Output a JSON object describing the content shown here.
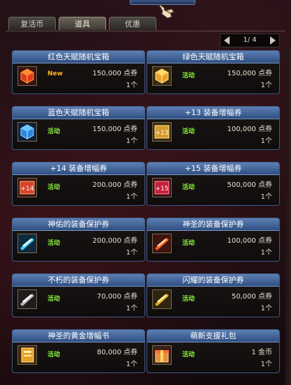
{
  "tabs": [
    {
      "label": "复活币",
      "active": false
    },
    {
      "label": "道具",
      "active": true
    },
    {
      "label": "优惠",
      "active": false
    }
  ],
  "pager": {
    "text": "1/ 4"
  },
  "items": [
    {
      "name": "红色天赋随机宝箱",
      "badge": "New",
      "badge_type": "new",
      "price": "150,000 点券",
      "qty": "1个",
      "icon": "red-box-icon"
    },
    {
      "name": "绿色天赋随机宝箱",
      "badge": "活动",
      "badge_type": "event",
      "price": "150,000 点券",
      "qty": "1个",
      "icon": "gold-box-icon"
    },
    {
      "name": "蓝色天赋随机宝箱",
      "badge": "活动",
      "badge_type": "event",
      "price": "150,000 点券",
      "qty": "1个",
      "icon": "blue-box-icon"
    },
    {
      "name": "+13 装备增幅券",
      "badge": "活动",
      "badge_type": "event",
      "price": "100,000 点券",
      "qty": "1个",
      "icon": "amplify-13-icon"
    },
    {
      "name": "+14 装备增幅券",
      "badge": "活动",
      "badge_type": "event",
      "price": "200,000 点券",
      "qty": "1个",
      "icon": "amplify-14-icon"
    },
    {
      "name": "+15 装备增幅券",
      "badge": "活动",
      "badge_type": "event",
      "price": "500,000 点券",
      "qty": "1个",
      "icon": "amplify-15-icon"
    },
    {
      "name": "神佑的装备保护券",
      "badge": "活动",
      "badge_type": "event",
      "price": "200,000 点券",
      "qty": "1个",
      "icon": "protect-blue-icon"
    },
    {
      "name": "神圣的装备保护券",
      "badge": "活动",
      "badge_type": "event",
      "price": "100,000 点券",
      "qty": "1个",
      "icon": "protect-red-icon"
    },
    {
      "name": "不朽的装备保护券",
      "badge": "活动",
      "badge_type": "event",
      "price": "70,000 点券",
      "qty": "1个",
      "icon": "protect-white-icon"
    },
    {
      "name": "闪耀的装备保护券",
      "badge": "活动",
      "badge_type": "event",
      "price": "50,000 点券",
      "qty": "1个",
      "icon": "protect-gold-icon"
    },
    {
      "name": "神圣的黄金增幅书",
      "badge": "活动",
      "badge_type": "event",
      "price": "80,000 点券",
      "qty": "1个",
      "icon": "gold-book-icon"
    },
    {
      "name": "萌新支援礼包",
      "badge": "活动",
      "badge_type": "event",
      "price": "1 金币",
      "qty": "1个",
      "icon": "gift-box-icon"
    }
  ],
  "colors": {
    "title_bar": "#4a6a9e",
    "event_badge": "#8bf33a",
    "new_badge": "#ffb21e"
  }
}
